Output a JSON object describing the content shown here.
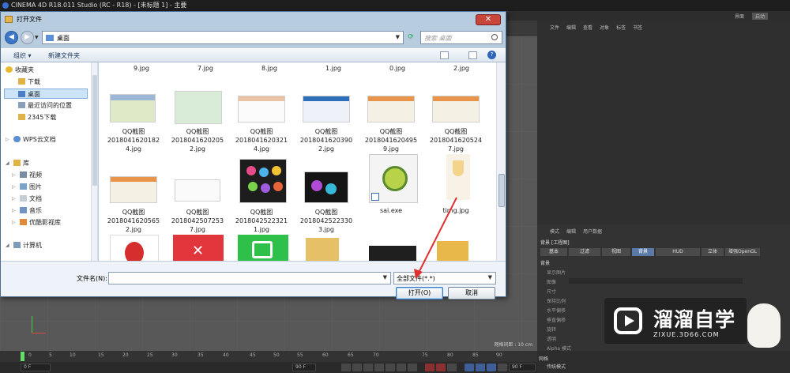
{
  "app": {
    "title": "CINEMA 4D R18.011 Studio (RC - R18) - [未标题 1] - 主要",
    "layout_tabs": [
      "界面",
      "启动"
    ]
  },
  "dialog": {
    "title": "打开文件",
    "close_label": "✕",
    "address": "桌面",
    "search_placeholder": "搜索 桌面",
    "toolbar": {
      "organize": "组织 ▾",
      "new_folder": "新建文件夹"
    },
    "nav": {
      "favorites": "收藏夹",
      "downloads": "下载",
      "desktop": "桌面",
      "recent": "最近访问的位置",
      "dl2345": "2345下载",
      "wps": "WPS云文档",
      "library": "库",
      "videos": "视频",
      "pictures": "图片",
      "documents": "文档",
      "music": "音乐",
      "youku": "优酷影视库",
      "computer": "计算机"
    },
    "files_partial_top": [
      "9.jpg",
      "7.jpg",
      "8.jpg",
      "1.jpg",
      "0.jpg",
      "2.jpg"
    ],
    "files_row2": [
      {
        "l1": "QQ截图",
        "l2": "2018041620182",
        "l3": "4.jpg"
      },
      {
        "l1": "QQ截图",
        "l2": "2018041620205",
        "l3": "2.jpg"
      },
      {
        "l1": "QQ截图",
        "l2": "2018041620321",
        "l3": "4.jpg"
      },
      {
        "l1": "QQ截图",
        "l2": "2018041620390",
        "l3": "2.jpg"
      },
      {
        "l1": "QQ截图",
        "l2": "2018041620495",
        "l3": "9.jpg"
      },
      {
        "l1": "QQ截图",
        "l2": "2018041620524",
        "l3": "7.jpg"
      }
    ],
    "files_row3": [
      {
        "l1": "QQ截图",
        "l2": "2018041620565",
        "l3": "2.jpg"
      },
      {
        "l1": "QQ截图",
        "l2": "2018042507253",
        "l3": "7.jpg"
      },
      {
        "l1": "QQ截图",
        "l2": "2018042522321",
        "l3": "1.jpg"
      },
      {
        "l1": "QQ截图",
        "l2": "2018042522330",
        "l3": "3.jpg"
      },
      {
        "l1": "sai.exe",
        "l2": "",
        "l3": ""
      },
      {
        "l1": "timg.jpg",
        "l2": "",
        "l3": ""
      }
    ],
    "filename_label": "文件名(N):",
    "filename_value": "",
    "filetype_value": "全部文件(*.*)",
    "open_label": "打开(O)",
    "cancel_label": "取消"
  },
  "c4d": {
    "object_menu": [
      "文件",
      "编辑",
      "查看",
      "对象",
      "标签",
      "书签"
    ],
    "attr_menu": [
      "模式",
      "编辑",
      "用户数据"
    ],
    "attr_subtitle": "背景 [工程图]",
    "attr_tabs": [
      "基本",
      "过滤",
      "视图",
      "背景",
      "HUD",
      "立体",
      "增强OpenGL"
    ],
    "attr_group": "背景",
    "attr_rows": [
      "显示图片",
      "图像",
      "尺寸",
      "保持比例",
      "水平偏移",
      "垂直偏移",
      "旋转",
      "透明",
      "Alpha 模式"
    ],
    "view_footer": "网格间距 : 10 cm",
    "timeline_ticks": [
      "0",
      "5",
      "10",
      "15",
      "20",
      "25",
      "30",
      "35",
      "40",
      "45",
      "50",
      "55",
      "60",
      "65",
      "70",
      "75",
      "80",
      "85",
      "90"
    ],
    "frame_start": "0 F",
    "frame_end": "90 F",
    "frame_end2": "90 F",
    "bottom_labels": [
      "网格",
      "传统模式"
    ]
  },
  "watermark": {
    "cn": "溜溜自学",
    "en": "ZIXUE.3D66.COM"
  },
  "colors": {
    "dialog_frame": "#b8cce0",
    "selection": "#cce4f7",
    "c4d_panel": "#333333",
    "arrow": "#e03030"
  }
}
